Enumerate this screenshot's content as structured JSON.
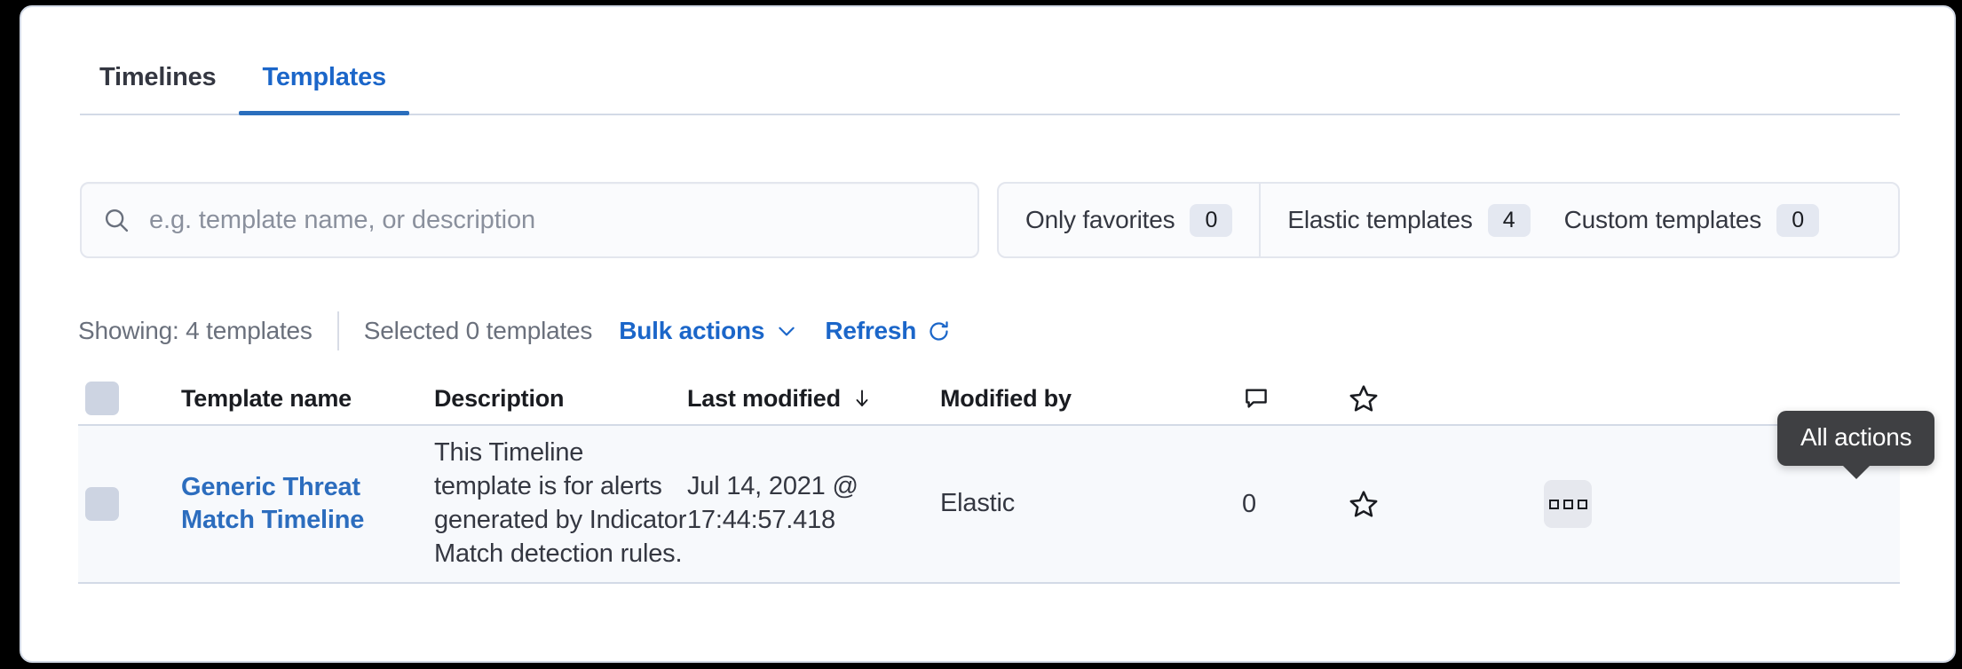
{
  "colors": {
    "accent_blue": "#1B66C9",
    "link_blue": "#2C6DBE",
    "tab_active_underline": "#2A6EBD",
    "text_dark": "#343741",
    "text_muted": "#6A707C",
    "row_bg": "#F7F9FC",
    "border": "#D3DAE6",
    "tooltip_bg": "#3F4043",
    "checkbox": "#CDD4E2"
  },
  "tabs": [
    {
      "label": "Timelines",
      "active": false
    },
    {
      "label": "Templates",
      "active": true
    }
  ],
  "search": {
    "icon": "search-icon",
    "placeholder": "e.g. template name, or description",
    "value": ""
  },
  "filters": [
    {
      "label": "Only favorites",
      "count": "0",
      "name": "only-favorites"
    },
    {
      "label": "Elastic templates",
      "count": "4",
      "name": "elastic-templates"
    },
    {
      "label": "Custom templates",
      "count": "0",
      "name": "custom-templates"
    }
  ],
  "toolbar": {
    "showing": "Showing: 4 templates",
    "selected": "Selected 0 templates",
    "bulk_actions": "Bulk actions",
    "bulk_actions_icon": "chevron-down-icon",
    "refresh": "Refresh",
    "refresh_icon": "refresh-icon"
  },
  "table": {
    "columns": [
      {
        "label": "",
        "name": "select-all-column"
      },
      {
        "label": "Template name",
        "name": "template-name-column"
      },
      {
        "label": "Description",
        "name": "description-column"
      },
      {
        "label": "Last modified",
        "name": "last-modified-column",
        "sort": "descending",
        "sort_icon": "arrow-down-icon"
      },
      {
        "label": "Modified by",
        "name": "modified-by-column"
      },
      {
        "label": "",
        "name": "notes-column",
        "icon": "comment-icon"
      },
      {
        "label": "",
        "name": "favorite-column",
        "icon": "star-icon"
      },
      {
        "label": "",
        "name": "actions-column"
      }
    ],
    "rows": [
      {
        "name": "Generic Threat Match Timeline",
        "description": "This Timeline template is for alerts generated by Indicator Match detection rules.",
        "last_modified": "Jul 14, 2021 @ 17:44:57.418",
        "modified_by": "Elastic",
        "notes_count": "0",
        "favorite_icon": "star-icon",
        "actions_icon": "all-actions-icon"
      }
    ]
  },
  "tooltip": {
    "text": "All actions"
  }
}
